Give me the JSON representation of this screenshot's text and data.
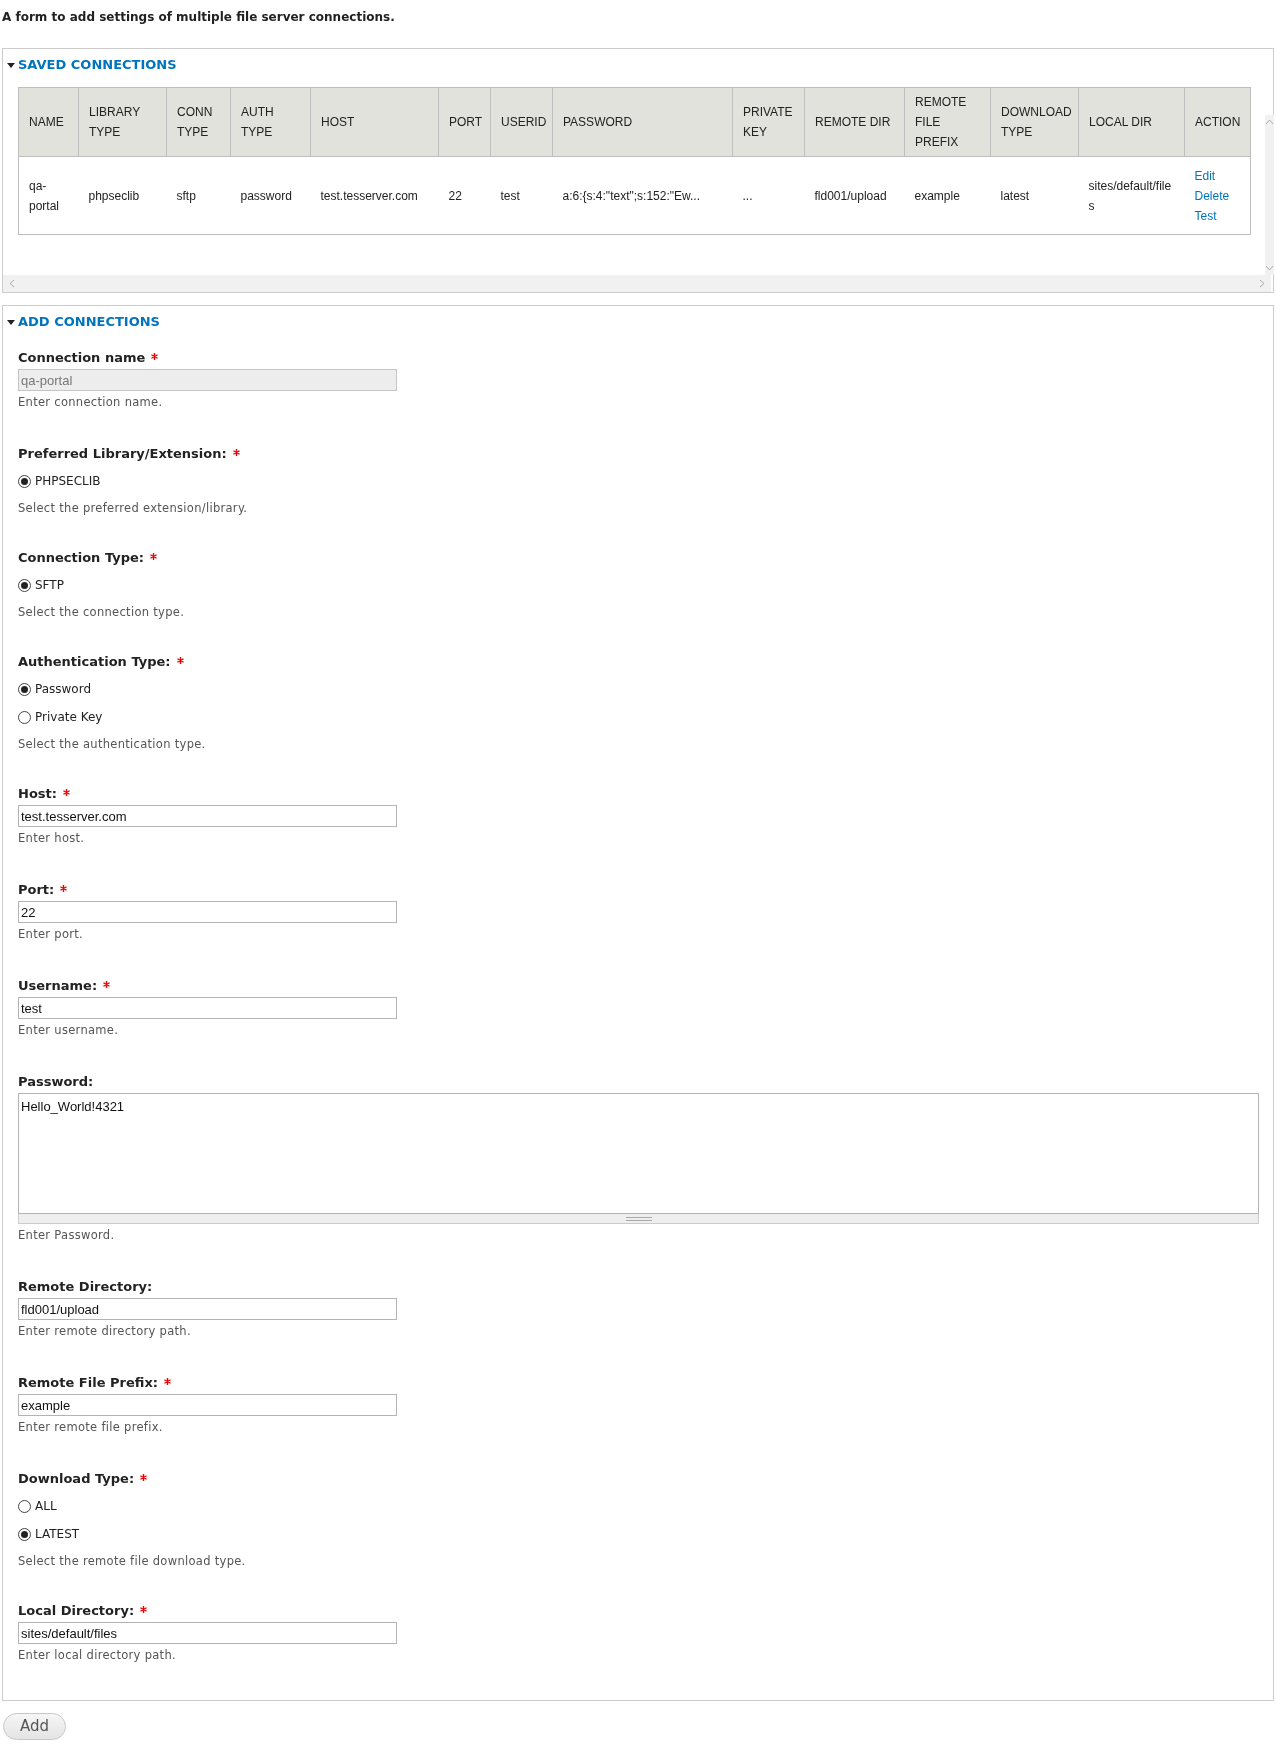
{
  "description": "A form to add settings of multiple file server connections.",
  "saved_connections": {
    "legend": "SAVED CONNECTIONS",
    "expanded": true,
    "columns": [
      "NAME",
      "LIBRARY TYPE",
      "CONN TYPE",
      "AUTH TYPE",
      "HOST",
      "PORT",
      "USERID",
      "PASSWORD",
      "PRIVATE KEY",
      "REMOTE DIR",
      "REMOTE FILE PREFIX",
      "DOWNLOAD TYPE",
      "LOCAL DIR",
      "ACTION"
    ],
    "rows": [
      {
        "cells": [
          "qa-portal",
          "phpseclib",
          "sftp",
          "password",
          "test.tesserver.com",
          "22",
          "test",
          "a:6:{s:4:\"text\";s:152:\"Ew...",
          "...",
          "fld001/upload",
          "example",
          "latest",
          "sites/default/files"
        ],
        "actions": [
          "Edit",
          "Delete",
          "Test"
        ]
      }
    ]
  },
  "add_connections": {
    "legend": "ADD CONNECTIONS",
    "expanded": true,
    "fields": [
      {
        "kind": "text",
        "label": "Connection name",
        "required": true,
        "value": "qa-portal",
        "disabled": true,
        "description": "Enter connection name."
      },
      {
        "kind": "radios",
        "label": "Preferred Library/Extension:",
        "required": true,
        "options": [
          {
            "label": "PHPSECLIB",
            "selected": true
          }
        ],
        "description": "Select the preferred extension/library."
      },
      {
        "kind": "radios",
        "label": "Connection Type:",
        "required": true,
        "options": [
          {
            "label": "SFTP",
            "selected": true
          }
        ],
        "description": "Select the connection type."
      },
      {
        "kind": "radios",
        "label": "Authentication Type:",
        "required": true,
        "options": [
          {
            "label": "Password",
            "selected": true
          },
          {
            "label": "Private Key",
            "selected": false
          }
        ],
        "description": "Select the authentication type."
      },
      {
        "kind": "text",
        "label": "Host:",
        "required": true,
        "value": "test.tesserver.com",
        "disabled": false,
        "description": "Enter host."
      },
      {
        "kind": "text",
        "label": "Port:",
        "required": true,
        "value": "22",
        "disabled": false,
        "description": "Enter port."
      },
      {
        "kind": "text",
        "label": "Username:",
        "required": true,
        "value": "test",
        "disabled": false,
        "description": "Enter username."
      },
      {
        "kind": "textarea",
        "label": "Password:",
        "required": false,
        "value": "Hello_World!4321",
        "description": "Enter Password."
      },
      {
        "kind": "text",
        "label": "Remote Directory:",
        "required": false,
        "value": "fld001/upload",
        "disabled": false,
        "description": "Enter remote directory path."
      },
      {
        "kind": "text",
        "label": "Remote File Prefix:",
        "required": true,
        "value": "example",
        "disabled": false,
        "description": "Enter remote file prefix."
      },
      {
        "kind": "radios",
        "label": "Download Type:",
        "required": true,
        "options": [
          {
            "label": "ALL",
            "selected": false
          },
          {
            "label": "LATEST",
            "selected": true
          }
        ],
        "description": "Select the remote file download type."
      },
      {
        "kind": "text",
        "label": "Local Directory:",
        "required": true,
        "value": "sites/default/files",
        "disabled": false,
        "description": "Enter local directory path."
      }
    ]
  },
  "add_button": "Add"
}
